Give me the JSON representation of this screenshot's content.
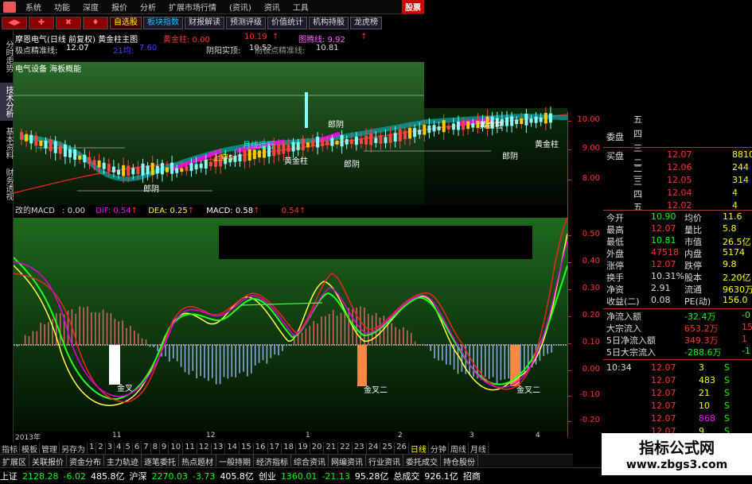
{
  "topbar": {
    "menu": [
      "系统",
      "功能",
      "深度",
      "报价",
      "分析",
      "扩展市场行情",
      "(资讯)",
      "资讯",
      "工具"
    ],
    "hot": "股票"
  },
  "toolbar": {
    "red_buttons": [
      "◀▶",
      "✚",
      "✖",
      "♦"
    ],
    "buttons": [
      "自选股",
      "板块指数",
      "财报解读",
      "预测评级",
      "价值统计",
      "机构持股",
      "龙虎榜"
    ]
  },
  "sidebar": {
    "tabs": [
      "分时走势",
      "技术分析",
      "基本资料",
      "财务透视"
    ]
  },
  "info": {
    "title": "摩恩电气(日线 前复权) 黄金柱主图",
    "jzd": "黄金柱: 0.00",
    "v1": "10.19",
    "v1_arrow": "↑",
    "tpx": "图腾线: 9.92",
    "tpx_arrow": "↑",
    "jd_label": "极点精准线:",
    "jd_val": "12.07",
    "sx_label": "21均:",
    "sx_val": "7.60",
    "yy_label": "阴阳实顶:",
    "yy_val": "10.52",
    "qj_label": "前极点精准线:",
    "qj_val": "10.81",
    "subtitle": "电气设备 海板概能"
  },
  "macd": {
    "label": "改的MACD",
    "v0": ": 0.00",
    "dif": "DIF: 0.54",
    "dif_arrow": "↑",
    "dea": "DEA: 0.25",
    "dea_arrow": "↑",
    "macd": "MACD: 0.58",
    "macd_arrow": "↑",
    "x": "0.54",
    "x_arrow": "↑"
  },
  "main_labels": {
    "yang": "郎阴",
    "jzz": "黄金柱",
    "bull": "上穿5",
    "long": "月线运行"
  },
  "macd_labels": {
    "jc1": "金叉",
    "jc2": "金叉二",
    "jc3": "金叉二"
  },
  "xaxis": {
    "labels": [
      "2013年",
      "11",
      "12",
      "1",
      "2",
      "3",
      "4"
    ]
  },
  "period": {
    "items": [
      "指标",
      "模板",
      "管理",
      "另存为",
      "1",
      "2",
      "3",
      "4",
      "5",
      "6",
      "7",
      "8",
      "9",
      "10",
      "11",
      "12",
      "13",
      "14",
      "15",
      "16",
      "17",
      "18",
      "19",
      "20",
      "21",
      "22",
      "23",
      "24",
      "25",
      "26",
      "日线",
      "分钟",
      "周线",
      "月线"
    ],
    "selected": "日线"
  },
  "tabs": {
    "items": [
      "扩展区",
      "关联报价",
      "资金分布",
      "主力轨迹",
      "逐笔委托",
      "热点题材",
      "一般持期",
      "经济指标",
      "综合资讯",
      "网编资讯",
      "行业资讯",
      "委托成交",
      "持仓股份"
    ]
  },
  "status": {
    "sh_label": "上证",
    "sh_val": "2128.28",
    "sh_chg": "-6.02",
    "sh_amt": "485.8亿",
    "hs_label": "沪深",
    "hs_val": "2270.03",
    "hs_chg": "-3.73",
    "hs_amt": "405.8亿",
    "cy_label": "创业",
    "cy_val": "1360.01",
    "cy_chg": "-21.13",
    "cy_amt": "95.28亿",
    "zc_label": "总成交",
    "zc_val": "926.1亿",
    "zs_label": "招商"
  },
  "yaxis": {
    "main": [
      "10.00",
      "9.00",
      "8.00"
    ],
    "macd": [
      "0.50",
      "0.40",
      "0.30",
      "0.20",
      "0.10",
      "0.00",
      "-0.10",
      "-0.20"
    ]
  },
  "quote": {
    "sell": [
      {
        "k": "五",
        "p": "",
        "v": ""
      },
      {
        "k": "四",
        "p": "",
        "v": ""
      },
      {
        "k": "三",
        "p": "",
        "v": ""
      },
      {
        "k": "二",
        "p": "",
        "v": ""
      },
      {
        "k": "一",
        "p": "",
        "v": ""
      }
    ],
    "sell_label": "委盘",
    "buy_label": "买盘",
    "buy": [
      {
        "k": "一",
        "p": "12.07",
        "v": "8810"
      },
      {
        "k": "二",
        "p": "12.06",
        "v": "244"
      },
      {
        "k": "三",
        "p": "12.05",
        "v": "314"
      },
      {
        "k": "四",
        "p": "12.04",
        "v": "4"
      },
      {
        "k": "五",
        "p": "12.02",
        "v": "4"
      }
    ],
    "stats": [
      {
        "a": "今开",
        "b": "10.90",
        "c": "均价",
        "d": "11.6"
      },
      {
        "a": "最高",
        "b": "12.07",
        "c": "量比",
        "d": "5.8"
      },
      {
        "a": "最低",
        "b": "10.81",
        "c": "市值",
        "d": "26.5亿"
      },
      {
        "a": "外盘",
        "b": "47518",
        "c": "内盘",
        "d": "5174"
      },
      {
        "a": "涨停",
        "b": "12.07",
        "c": "跌停",
        "d": "9.8"
      },
      {
        "a": "换手",
        "b": "10.31%",
        "c": "股本",
        "d": "2.20亿"
      },
      {
        "a": "净资",
        "b": "2.91",
        "c": "流通",
        "d": "9630万"
      },
      {
        "a": "收益(二)",
        "b": "0.08",
        "c": "PE(动)",
        "d": "156.0"
      }
    ],
    "flows": [
      {
        "a": "净流入额",
        "b": "-32.4万",
        "c": "-0"
      },
      {
        "a": "大宗流入",
        "b": "653.2万",
        "c": "15"
      },
      {
        "a": "5日净流入额",
        "b": "349.3万",
        "c": "1"
      },
      {
        "a": "5日大宗流入",
        "b": "-288.6万",
        "c": "-1"
      }
    ],
    "trades": [
      {
        "t": "10:34",
        "p": "12.07",
        "v": "3",
        "s": "S"
      },
      {
        "t": "",
        "p": "12.07",
        "v": "483",
        "s": "S"
      },
      {
        "t": "",
        "p": "12.07",
        "v": "21",
        "s": "S"
      },
      {
        "t": "",
        "p": "12.07",
        "v": "10",
        "s": "S"
      },
      {
        "t": "",
        "p": "12.07",
        "v": "868",
        "s": "S"
      },
      {
        "t": "",
        "p": "12.07",
        "v": "9",
        "s": "S"
      },
      {
        "t": "",
        "p": "12.07",
        "v": "8",
        "s": "S"
      }
    ]
  },
  "watermark": {
    "title": "指标公式网",
    "url": "www.zbgs3.com"
  }
}
